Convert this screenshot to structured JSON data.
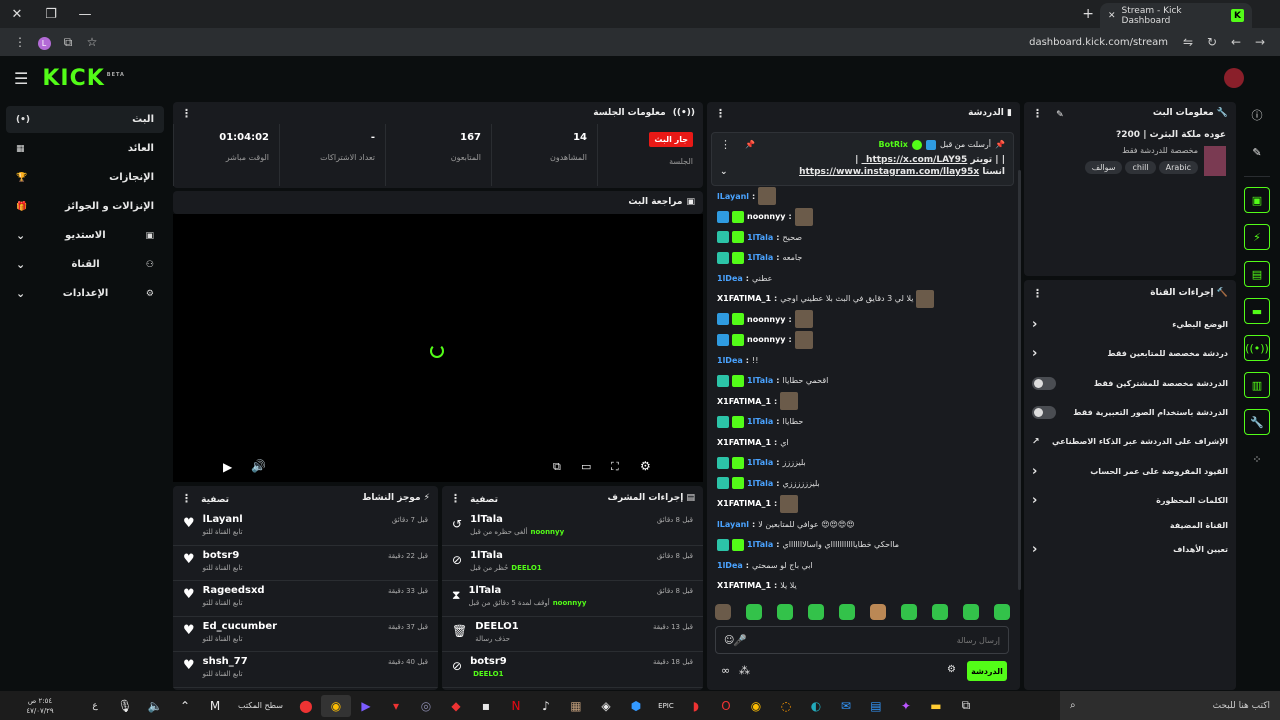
{
  "browser": {
    "tab_title": "Stream - Kick Dashboard",
    "tab_favicon": "K",
    "url": "dashboard.kick.com/stream",
    "profile_initial": "L"
  },
  "header": {
    "logo": "KICK",
    "logo_sup": "BETA"
  },
  "nav": [
    {
      "label": "البث",
      "icon": "(•)"
    },
    {
      "label": "العائد",
      "icon": "▦"
    },
    {
      "label": "الإنجازات",
      "icon": "🏆"
    },
    {
      "label": "الإنزالات و الجوائز",
      "icon": "🎁"
    },
    {
      "label": "الاستديو",
      "icon": "▣"
    },
    {
      "label": "القناة",
      "icon": "⚇"
    },
    {
      "label": "الإعدادات",
      "icon": "⚙"
    }
  ],
  "session": {
    "title": "معلومات الجلسة",
    "stats": [
      {
        "value": "01:04:02",
        "label": "الوقت مباشر"
      },
      {
        "value": "-",
        "label": "تعداد الاشتراكات"
      },
      {
        "value": "167",
        "label": "المتابعون"
      },
      {
        "value": "14",
        "label": "المشاهدون"
      },
      {
        "value": "جار البث",
        "label": "الجلسة"
      }
    ]
  },
  "preview": {
    "title": "مراجعة البث"
  },
  "activity": {
    "title": "موجز النشاط",
    "filter": "تصفية",
    "items": [
      {
        "name": "lLayanl",
        "sub": "تابع القناة للتو",
        "time": "قبل 7 دقائق"
      },
      {
        "name": "botsr9",
        "sub": "تابع القناة للتو",
        "time": "قبل 22 دقيقة"
      },
      {
        "name": "Rageedsxd",
        "sub": "تابع القناة للتو",
        "time": "قبل 33 دقيقة"
      },
      {
        "name": "Ed_cucumber",
        "sub": "تابع القناة للتو",
        "time": "قبل 37 دقيقة"
      },
      {
        "name": "shsh_77",
        "sub": "تابع القناة للتو",
        "time": "قبل 40 دقيقة"
      }
    ]
  },
  "modactions": {
    "title": "إجراءات المشرف",
    "filter": "تصفية",
    "items": [
      {
        "name": "1lTala",
        "sub": "ألغى حظره من قبل",
        "target": "noonnyy",
        "time": "قبل 8 دقائق",
        "icon": "↺"
      },
      {
        "name": "1lTala",
        "sub": "حُظر من قبل",
        "target": "DEELO1",
        "time": "قبل 8 دقائق",
        "icon": "⊘"
      },
      {
        "name": "1lTala",
        "sub": "أوقف لمدة 5 دقائق من قبل",
        "target": "noonnyy",
        "time": "قبل 8 دقائق",
        "icon": "⧗"
      },
      {
        "name": "DEELO1",
        "sub": "حذف رسالة",
        "target": "",
        "time": "قبل 13 دقيقة",
        "icon": "🗑"
      },
      {
        "name": "botsr9",
        "sub": "",
        "target": "DEELO1",
        "time": "قبل 18 دقيقة",
        "icon": "⊘"
      }
    ]
  },
  "chat": {
    "title": "الدردشة",
    "pinned": {
      "by_label": "أرسلت من قبل",
      "by": "BotRix",
      "line1_prefix": "| |",
      "line1_text": "تويتر",
      "line1_link": "https://x.com/LAY95_",
      "line1_suffix": "|",
      "line2_link": "https://www.instagram.com/llay95x",
      "line2_text": "انستا"
    },
    "messages": [
      {
        "user": "lLayanl",
        "text": "",
        "color": "#4aa3ff",
        "emote": true
      },
      {
        "user": "noonnyy",
        "text": "",
        "color": "#ffffff",
        "emote": true,
        "badges": 2
      },
      {
        "user": "1lTala",
        "text": "صحيح",
        "color": "#4aa3ff",
        "badges": 1
      },
      {
        "user": "1lTala",
        "text": "جامعه",
        "color": "#4aa3ff",
        "badges": 1
      },
      {
        "user": "1lDea",
        "text": "عطني",
        "color": "#4aa3ff"
      },
      {
        "user": "X1FATIMA_1",
        "text": "يلا لي 3 دقايق في البث بلا عطيني اوجي",
        "color": "#ffffff",
        "emote": true
      },
      {
        "user": "noonnyy",
        "text": "",
        "color": "#ffffff",
        "emote": true,
        "badges": 2
      },
      {
        "user": "noonnyy",
        "text": "",
        "color": "#ffffff",
        "emote": true,
        "badges": 2
      },
      {
        "user": "1lDea",
        "text": "!!",
        "color": "#4aa3ff"
      },
      {
        "user": "1lTala",
        "text": "اقحمي حطاياا",
        "color": "#4aa3ff",
        "badges": 1
      },
      {
        "user": "X1FATIMA_1",
        "text": "",
        "color": "#ffffff",
        "emote": true
      },
      {
        "user": "1lTala",
        "text": "حطاياا",
        "color": "#4aa3ff",
        "badges": 1
      },
      {
        "user": "X1FATIMA_1",
        "text": "اي",
        "color": "#ffffff"
      },
      {
        "user": "1lTala",
        "text": "بليزززز",
        "color": "#4aa3ff",
        "badges": 1
      },
      {
        "user": "1lTala",
        "text": "بليززززززي",
        "color": "#4aa3ff",
        "badges": 1
      },
      {
        "user": "X1FATIMA_1",
        "text": "",
        "color": "#ffffff",
        "emote": true
      },
      {
        "user": "lLayanl",
        "text": "😍😍😍😍 عوافي للمتابعين لا",
        "color": "#4aa3ff"
      },
      {
        "user": "1lTala",
        "text": "مااحكي خطاياااااااااااي واسالاااااااي",
        "color": "#4aa3ff",
        "badges": 1
      },
      {
        "user": "1lDea",
        "text": "ابي باج لو سمحتي",
        "color": "#4aa3ff"
      },
      {
        "user": "X1FATIMA_1",
        "text": "يلا يلا",
        "color": "#ffffff"
      }
    ],
    "input_placeholder": "إرسال رسالة",
    "send_label": "الدردشة"
  },
  "streaminfo": {
    "title": "معلومات البث",
    "stream_title": "عوده ملكة البثرث | 200?",
    "category": "مخصصة للدردشة فقط",
    "tags": [
      "سوالف",
      "chill",
      "Arabic"
    ]
  },
  "channelactions": {
    "title": "إجراءات القناة",
    "items": [
      {
        "label": "الوضع البطيء",
        "control": "chevron"
      },
      {
        "label": "دردشة مخصصة للمتابعين فقط",
        "control": "chevron"
      },
      {
        "label": "الدردشة مخصصة للمشتركين فقط",
        "control": "toggle"
      },
      {
        "label": "الدردشة باستخدام الصور التعبيرية فقط",
        "control": "toggle"
      },
      {
        "label": "الإشراف على الدردشة عبر الذكاء الاصطناعي",
        "control": "external"
      },
      {
        "label": "القيود المفروضة على عمر الحساب",
        "control": "chevron"
      },
      {
        "label": "الكلمات المحظورة",
        "control": "chevron"
      },
      {
        "label": "القناة المضيفة",
        "control": "none"
      },
      {
        "label": "تعيين الأهداف",
        "control": "chevron"
      }
    ]
  },
  "taskbar": {
    "search_placeholder": "اكتب هنا للبحث",
    "time": "٢:٥٤ ص",
    "date": "٤٧/٠٧/٢٩",
    "desktop_label": "سطح المكتب",
    "lang": "ع"
  }
}
